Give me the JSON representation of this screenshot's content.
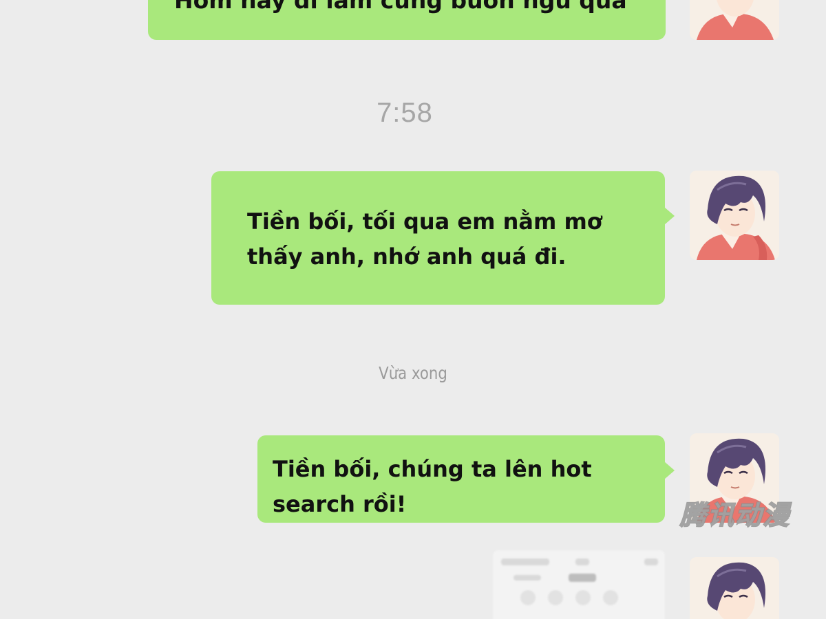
{
  "conversation": {
    "timestamps": [
      "7:58",
      "Vừa xong"
    ],
    "messages": [
      {
        "text": "Hôm nay đi làm cũng buồn ngủ quá",
        "sender": "self"
      },
      {
        "text": "Tiền bối, tối qua em nằm mơ thấy anh, nhớ anh quá đi.",
        "sender": "self"
      },
      {
        "text": "Tiền bối, chúng ta lên hot search rồi!",
        "sender": "self"
      },
      {
        "type": "screenshot-image",
        "sender": "self"
      }
    ]
  },
  "watermark": {
    "text": "腾讯动漫"
  },
  "colors": {
    "background": "#ececec",
    "bubble": "#a9e87c",
    "timestamp": "#a6a6a6",
    "text": "#111111"
  },
  "icons": [
    "user-avatar"
  ]
}
